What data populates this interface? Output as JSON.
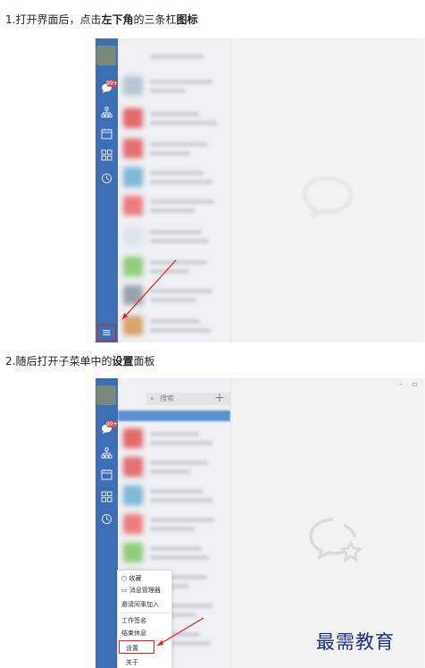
{
  "step1": {
    "prefix": "1.打开界面后，点击",
    "bold1": "左下角",
    "middle": "的三条杠",
    "bold2": "图标"
  },
  "step2": {
    "prefix": "2.随后打开子菜单中的",
    "bold1": "设置",
    "suffix": "面板"
  },
  "shot1": {
    "badge": "99+",
    "menu_icon": "≡"
  },
  "shot2": {
    "badge": "99+",
    "search_placeholder": "搜索",
    "add_button": "+",
    "minimize": "–",
    "maximize": "▫",
    "menu_items": [
      "收藏",
      "消息管理器",
      "邀请同事加入",
      "工作签名",
      "结束休息",
      "设置",
      "关于"
    ]
  },
  "watermark": "最需教育",
  "colors": {
    "sidebar": "#3d6fb6",
    "highlight": "#e02020",
    "badge": "#e84b3c",
    "watermark": "#1c2d8c"
  }
}
